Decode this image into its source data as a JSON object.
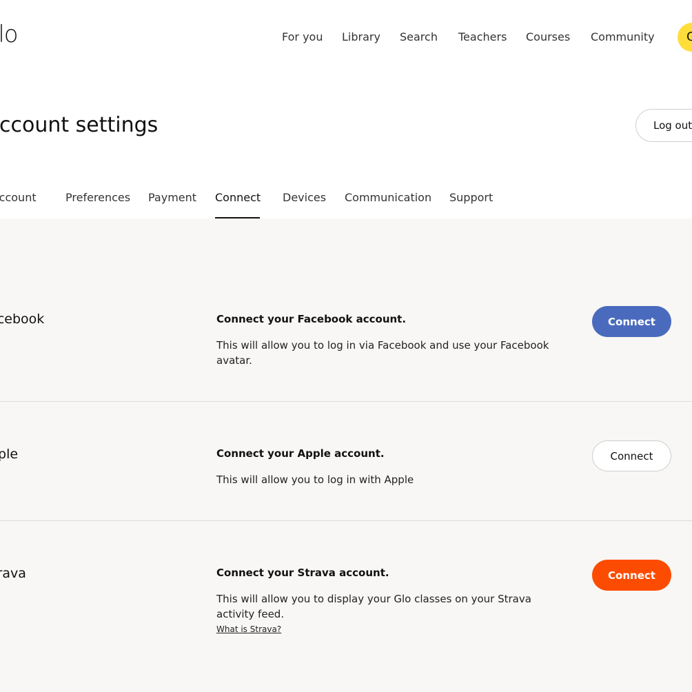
{
  "header": {
    "logo": "Glo",
    "nav": [
      "For you",
      "Library",
      "Search",
      "Teachers",
      "Courses",
      "Community"
    ],
    "avatar_initial": "G"
  },
  "page": {
    "title": "Account settings",
    "logout_label": "Log out"
  },
  "tabs": {
    "items": [
      "Account",
      "Preferences",
      "Payment",
      "Connect",
      "Devices",
      "Communication",
      "Support"
    ],
    "active": "Connect"
  },
  "services": [
    {
      "name": "Facebook",
      "heading": "Connect your Facebook account.",
      "description": "This will allow you to log in via Facebook and use your Facebook avatar.",
      "button_label": "Connect",
      "button_color": "#4a6bbd"
    },
    {
      "name": "Apple",
      "heading": "Connect your Apple account.",
      "description": "This will allow you to log in with Apple",
      "button_label": "Connect",
      "button_color": "#ffffff"
    },
    {
      "name": "Strava",
      "heading": "Connect your Strava account.",
      "description": "This will allow you to display your Glo classes on your Strava activity feed.",
      "link": "What is Strava?",
      "button_label": "Connect",
      "button_color": "#fc4c02"
    }
  ],
  "colors": {
    "accent_yellow": "#ffde3b",
    "content_background": "#f8f7f5"
  }
}
